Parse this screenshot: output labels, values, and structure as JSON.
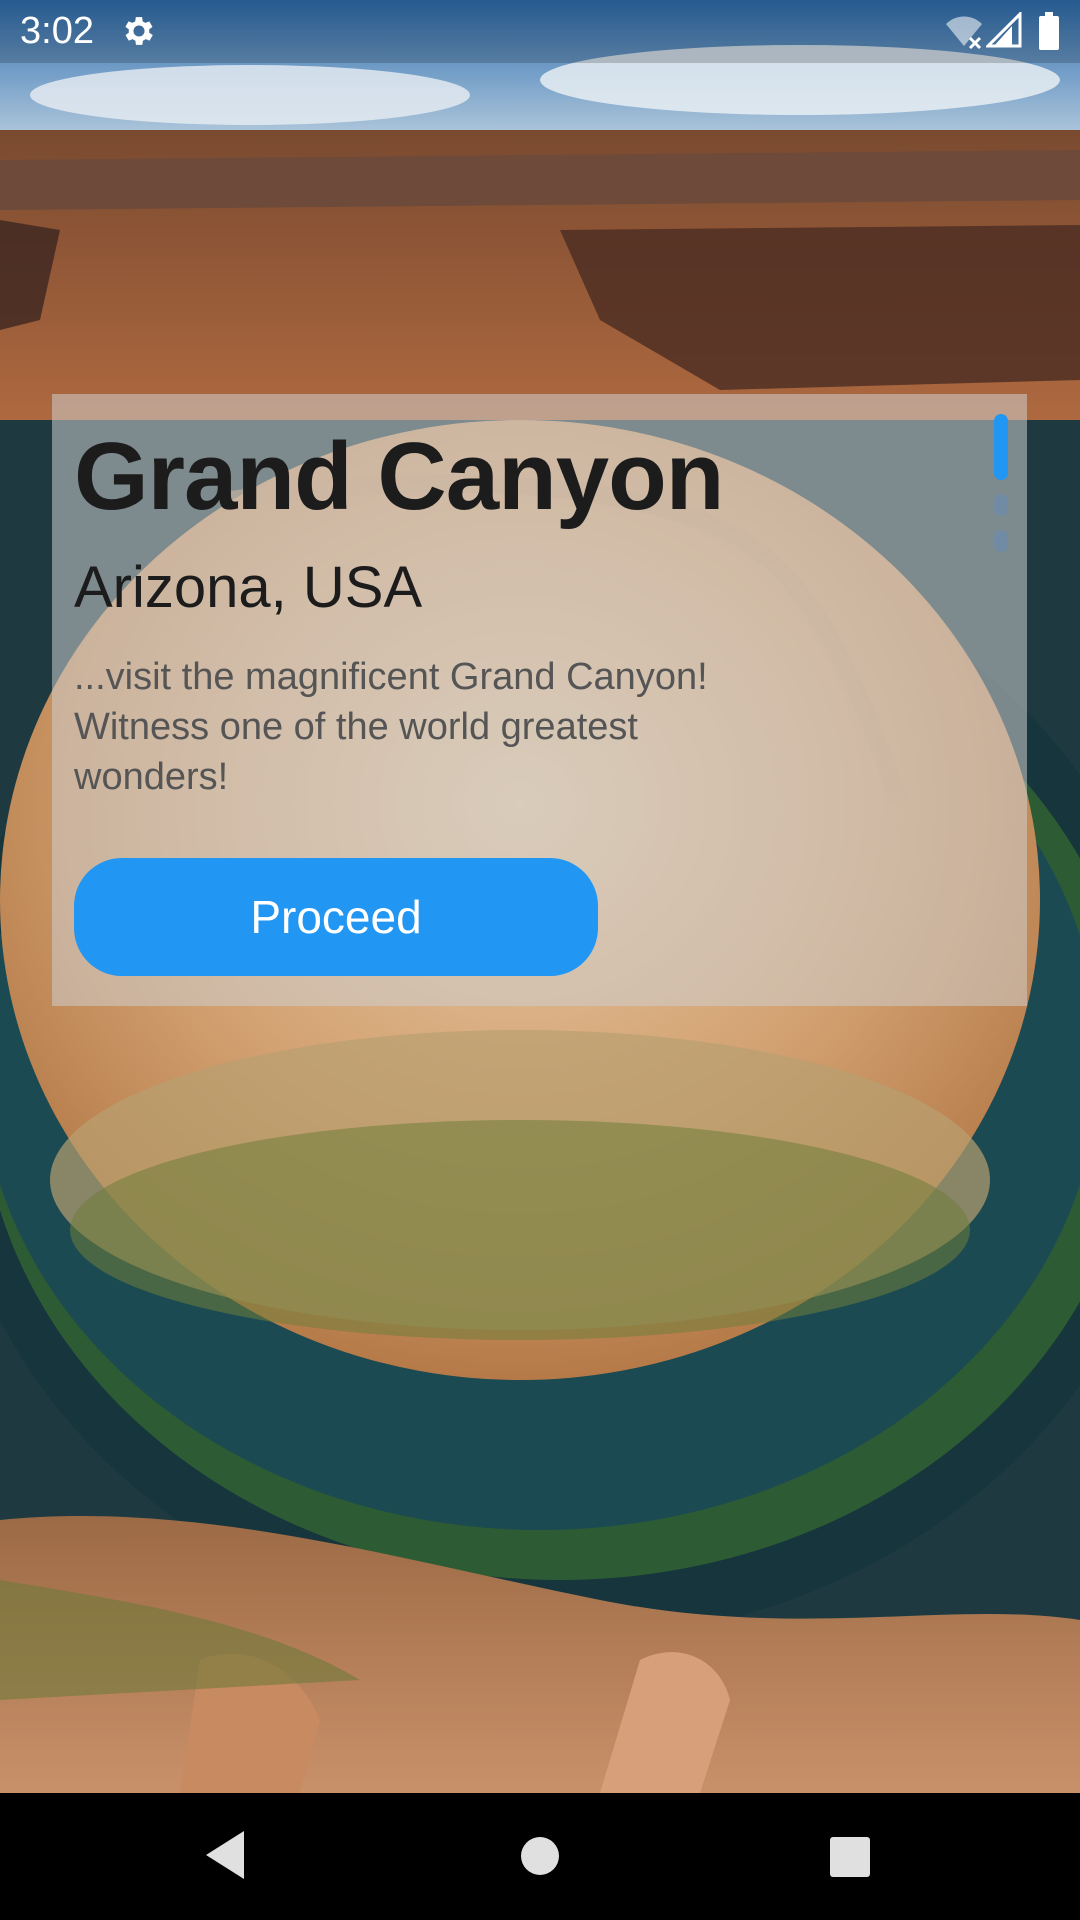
{
  "status_bar": {
    "time": "3:02",
    "settings_icon": "gear-icon",
    "wifi_icon": "wifi-off-icon",
    "signal_icon": "cell-signal-icon",
    "battery_icon": "battery-full-icon"
  },
  "card": {
    "title": "Grand Canyon",
    "subtitle": "Arizona, USA",
    "description": "...visit the magnificent Grand Canyon! Witness one of the world greatest wonders!",
    "button_label": "Proceed",
    "accent_color": "#2196f3",
    "page_indicator": {
      "current": 1,
      "total": 3
    }
  },
  "nav_bar": {
    "back_icon": "back-triangle-icon",
    "home_icon": "home-circle-icon",
    "recents_icon": "recents-square-icon"
  }
}
